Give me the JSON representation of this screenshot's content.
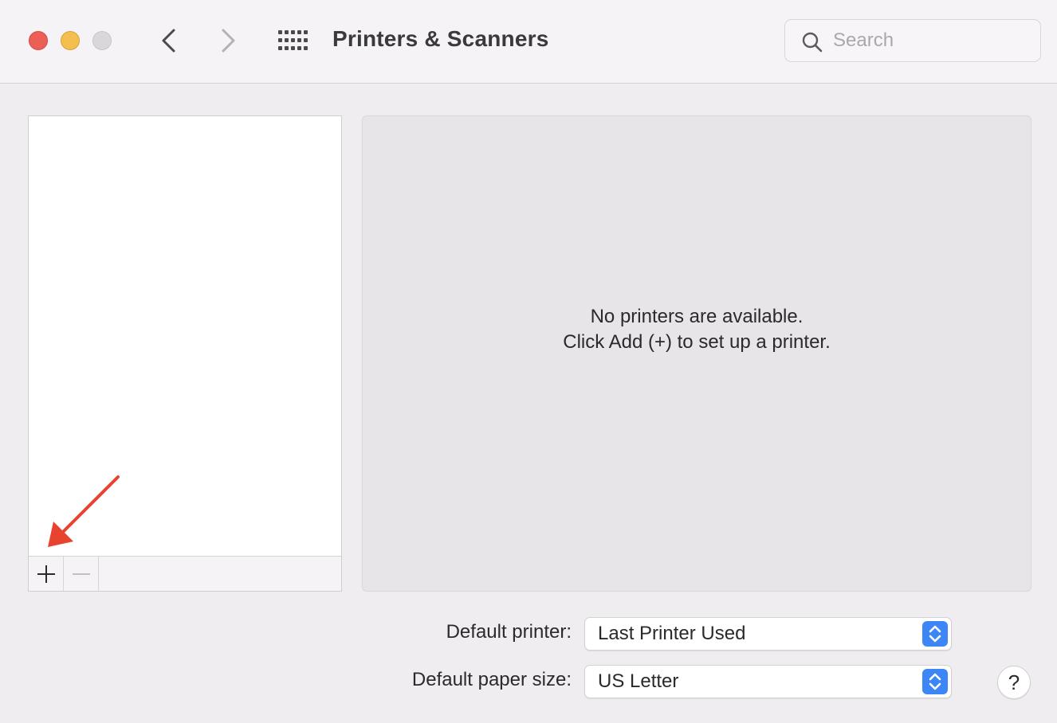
{
  "window": {
    "title": "Printers & Scanners"
  },
  "toolbar": {
    "traffic_lights": [
      "close",
      "minimize",
      "zoom"
    ],
    "back_icon": "chevron-left-icon",
    "forward_icon": "chevron-right-icon",
    "grid_icon": "show-all-grid-icon",
    "search": {
      "placeholder": "Search",
      "value": ""
    }
  },
  "printer_list": {
    "items": [],
    "add_button": "+",
    "remove_button": "−"
  },
  "detail": {
    "empty_line1": "No printers are available.",
    "empty_line2": "Click Add (+) to set up a printer."
  },
  "settings": {
    "default_printer_label": "Default printer:",
    "default_printer_value": "Last Printer Used",
    "default_paper_label": "Default paper size:",
    "default_paper_value": "US Letter"
  },
  "help": {
    "label": "?"
  },
  "colors": {
    "close": "#ec5f57",
    "minimize": "#f4bf4f",
    "zoom": "#d9d7da",
    "accent": "#3d86f5",
    "annotation_arrow": "#e8432f"
  }
}
